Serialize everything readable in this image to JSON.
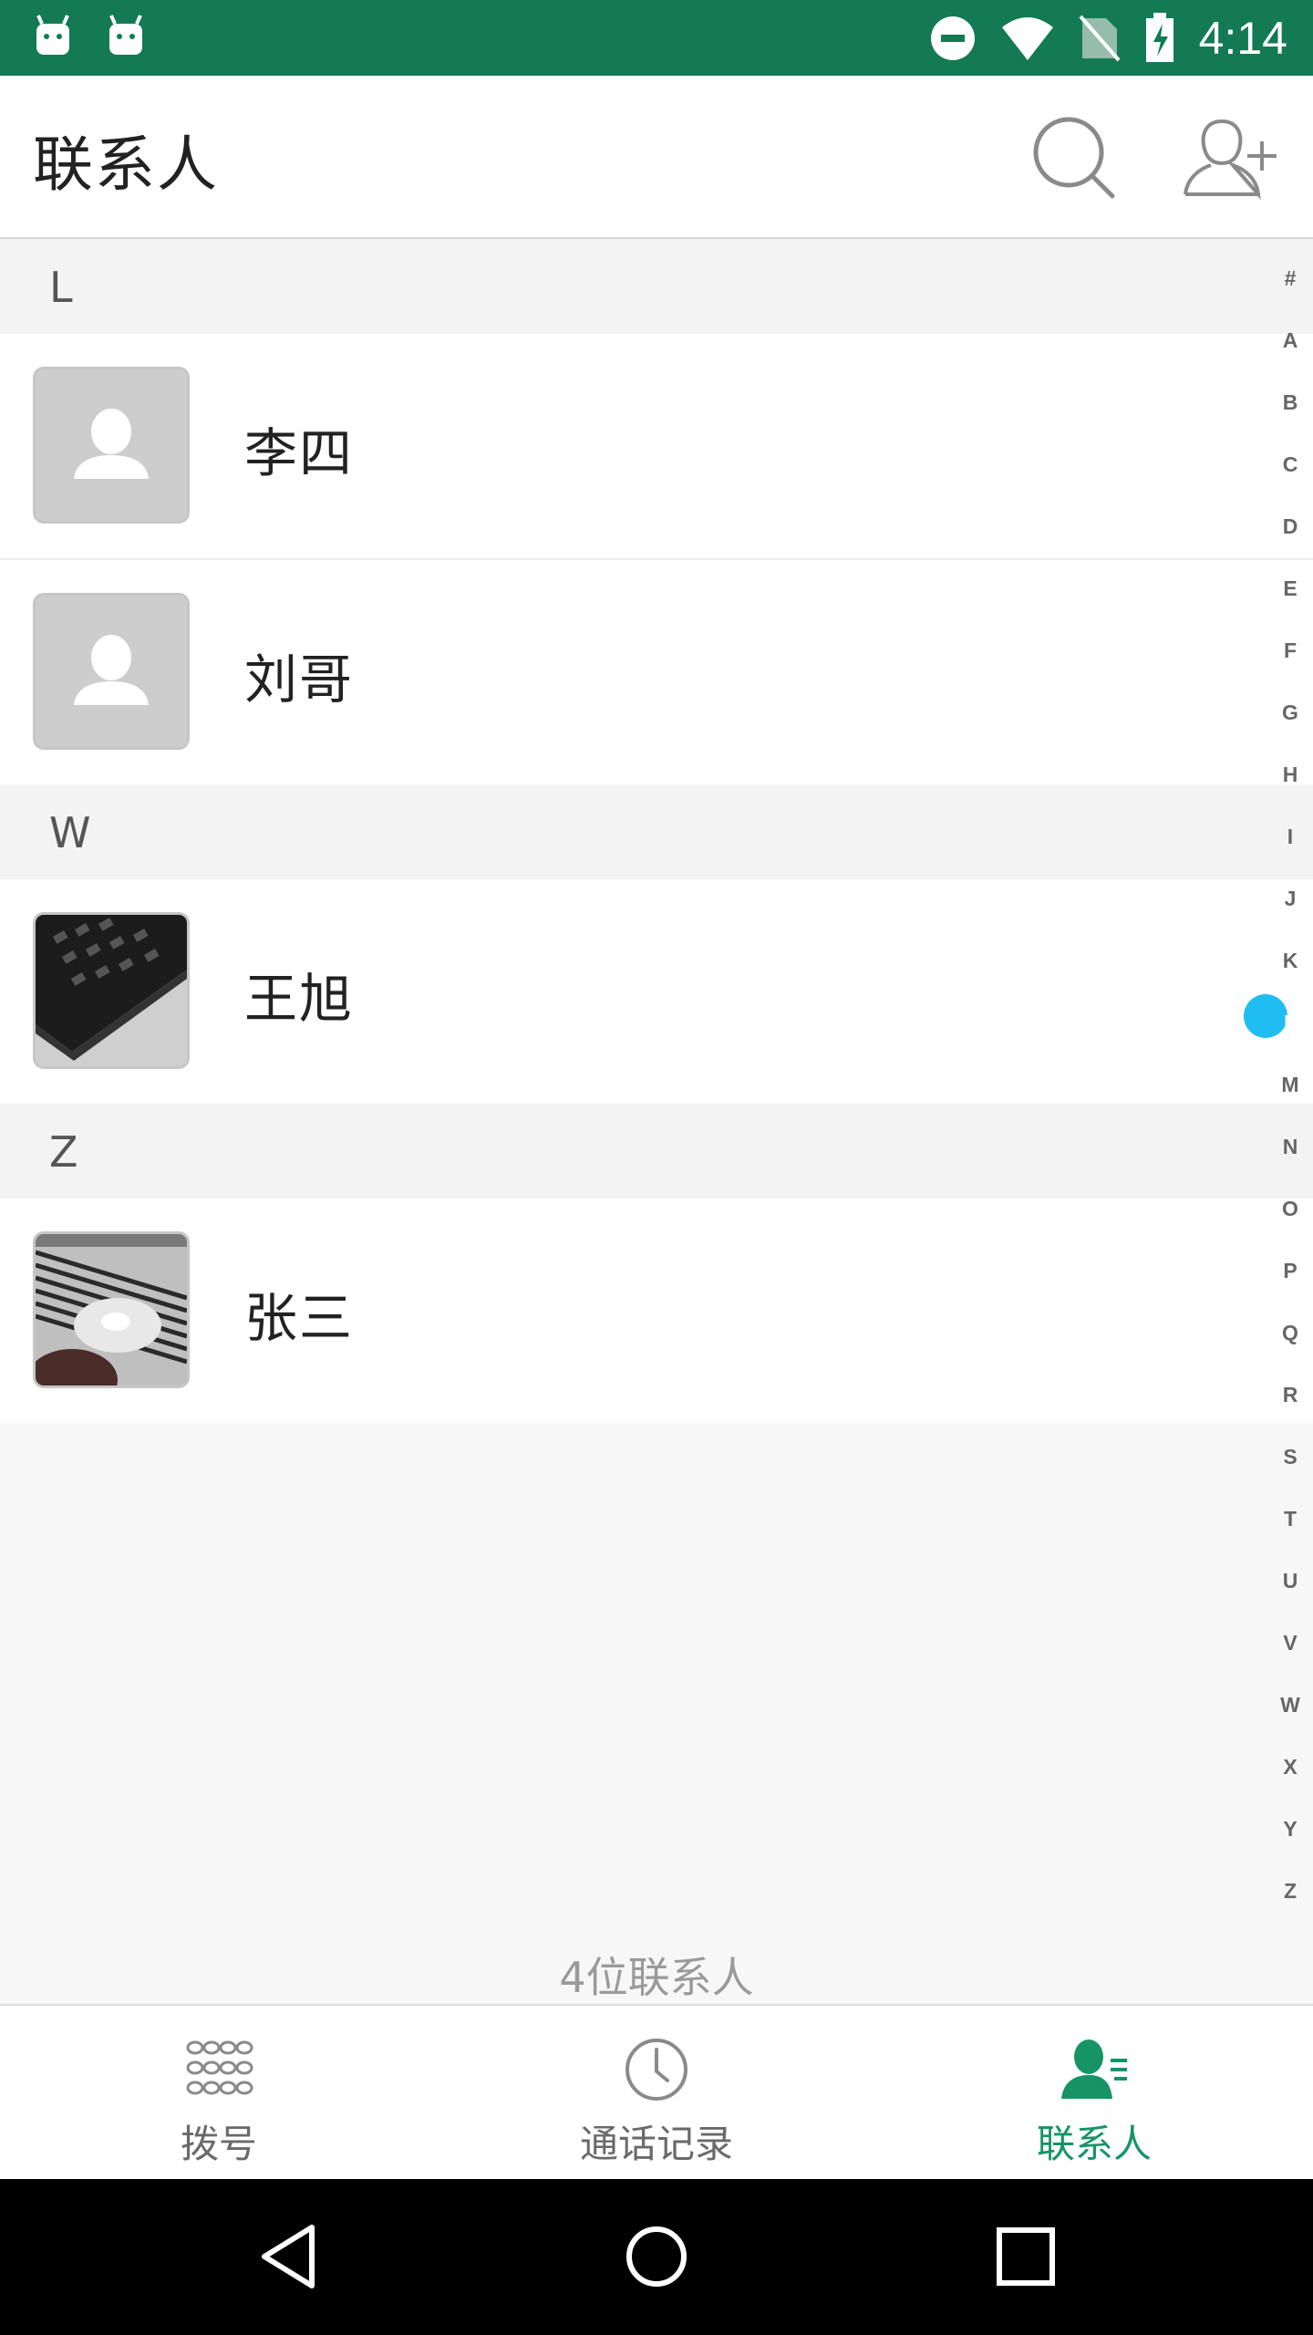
{
  "status_bar": {
    "time": "4:14",
    "icons": [
      "android-notification-icon",
      "android-notification-icon",
      "do-not-disturb-icon",
      "wifi-icon",
      "no-sim-icon",
      "battery-charging-icon"
    ],
    "background_color": "#137a53"
  },
  "app_bar": {
    "title": "联系人",
    "search_icon": "search-icon",
    "add_contact_icon": "add-contact-icon"
  },
  "sections": [
    {
      "letter": "L",
      "contacts": [
        {
          "name": "李四",
          "avatar": "default-avatar"
        },
        {
          "name": "刘哥",
          "avatar": "default-avatar"
        }
      ]
    },
    {
      "letter": "W",
      "contacts": [
        {
          "name": "王旭",
          "avatar": "photo-keyboard"
        }
      ]
    },
    {
      "letter": "Z",
      "contacts": [
        {
          "name": "张三",
          "avatar": "photo-surface"
        }
      ]
    }
  ],
  "index_bar": {
    "letters": [
      "#",
      "A",
      "B",
      "C",
      "D",
      "E",
      "F",
      "G",
      "H",
      "I",
      "J",
      "K",
      "L",
      "M",
      "N",
      "O",
      "P",
      "Q",
      "R",
      "S",
      "T",
      "U",
      "V",
      "W",
      "X",
      "Y",
      "Z"
    ],
    "active": "L",
    "active_color": "#20bdf2"
  },
  "footer": {
    "contact_count": "4位联系人"
  },
  "tabs": [
    {
      "label": "拨号",
      "icon": "dialpad-icon",
      "active": false
    },
    {
      "label": "通话记录",
      "icon": "clock-icon",
      "active": false
    },
    {
      "label": "联系人",
      "icon": "contacts-icon",
      "active": true
    }
  ],
  "accent_color": "#169466",
  "nav_bar": {
    "buttons": [
      "back-icon",
      "home-icon",
      "recents-icon"
    ]
  }
}
